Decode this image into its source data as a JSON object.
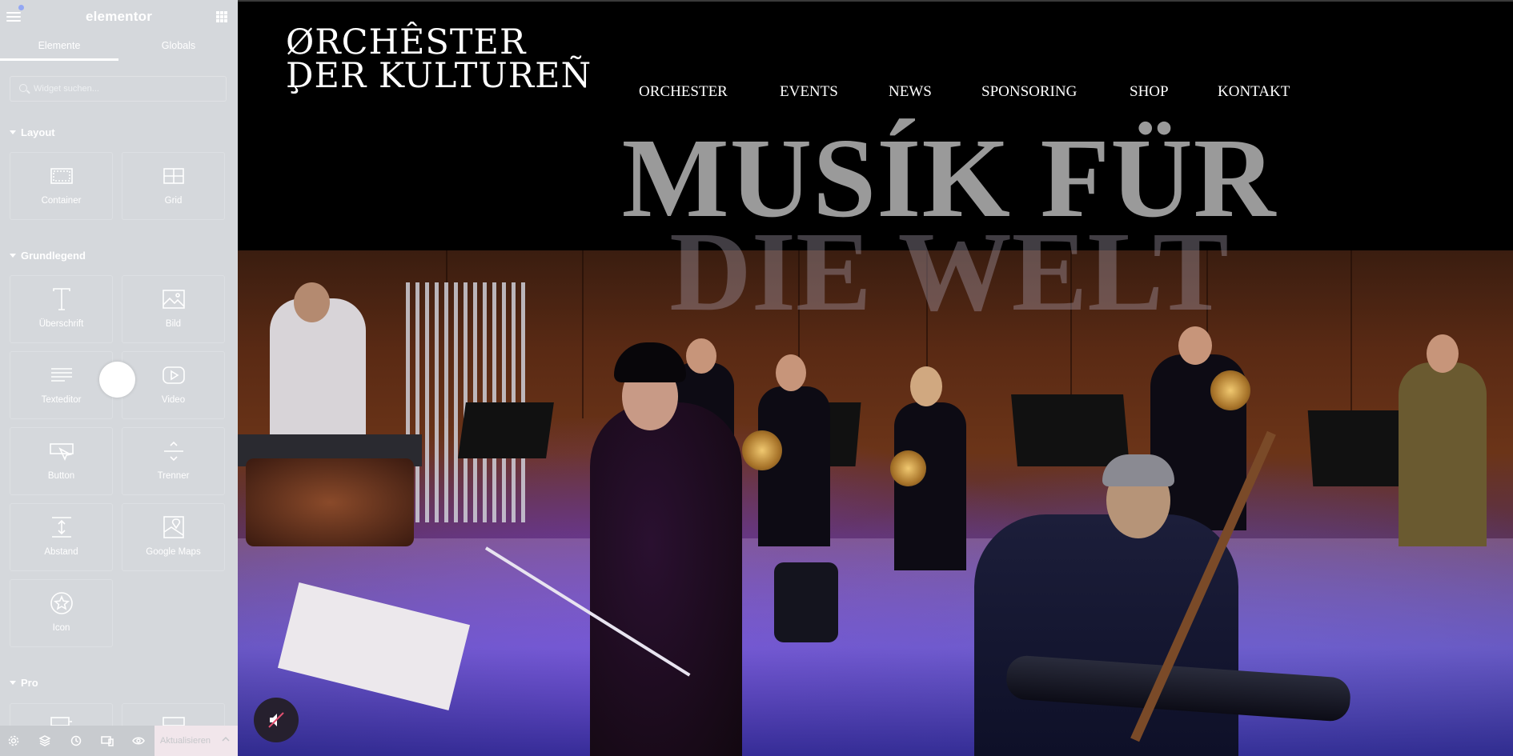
{
  "editor": {
    "logo": "elementor",
    "tabs": [
      {
        "label": "Elemente",
        "active": true
      },
      {
        "label": "Globals",
        "active": false
      }
    ],
    "search_placeholder": "Widget suchen...",
    "sections": [
      {
        "title": "Layout",
        "widgets": [
          {
            "label": "Container",
            "icon": "container-icon"
          },
          {
            "label": "Grid",
            "icon": "grid-icon"
          }
        ]
      },
      {
        "title": "Grundlegend",
        "widgets": [
          {
            "label": "Überschrift",
            "icon": "heading-icon"
          },
          {
            "label": "Bild",
            "icon": "image-icon"
          },
          {
            "label": "Texteditor",
            "icon": "text-editor-icon"
          },
          {
            "label": "Video",
            "icon": "video-icon"
          },
          {
            "label": "Button",
            "icon": "button-icon"
          },
          {
            "label": "Trenner",
            "icon": "divider-icon"
          },
          {
            "label": "Abstand",
            "icon": "spacer-icon"
          },
          {
            "label": "Google Maps",
            "icon": "map-icon"
          },
          {
            "label": "Icon",
            "icon": "star-icon"
          }
        ]
      },
      {
        "title": "Pro",
        "widgets": []
      }
    ],
    "footer": {
      "update_label": "Aktualisieren",
      "icons": [
        "settings-icon",
        "layers-icon",
        "history-icon",
        "responsive-icon",
        "preview-eye-icon"
      ]
    },
    "colors": {
      "panel": "#d5d8dc",
      "accent": "#93a7f3"
    }
  },
  "site": {
    "logo_lines": [
      "ØRCHÊSTER",
      "ḐER KULTUREÑ"
    ],
    "nav": [
      "ORCHESTER",
      "EVENTS",
      "NEWS",
      "SPONSORING",
      "SHOP",
      "KONTAKT"
    ],
    "hero_line1": "MUSÍK FÜR",
    "hero_line2": "DIE WELT",
    "video_muted": true
  }
}
